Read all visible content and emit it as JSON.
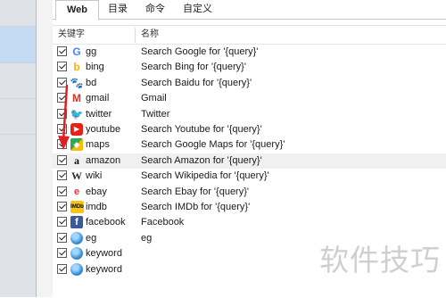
{
  "tabs": [
    {
      "label": "Web",
      "active": true
    },
    {
      "label": "目录",
      "active": false
    },
    {
      "label": "命令",
      "active": false
    },
    {
      "label": "自定义",
      "active": false
    }
  ],
  "table": {
    "columns": [
      "关键字",
      "名称"
    ],
    "rows": [
      {
        "keyword": "gg",
        "name": "Search Google for '{query}'",
        "icon": "google-icon",
        "checked": true
      },
      {
        "keyword": "bing",
        "name": "Search Bing for '{query}'",
        "icon": "bing-icon",
        "checked": true
      },
      {
        "keyword": "bd",
        "name": "Search Baidu for '{query}'",
        "icon": "baidu-icon",
        "checked": true
      },
      {
        "keyword": "gmail",
        "name": "Gmail",
        "icon": "gmail-icon",
        "checked": true
      },
      {
        "keyword": "twitter",
        "name": "Twitter",
        "icon": "twitter-icon",
        "checked": true
      },
      {
        "keyword": "youtube",
        "name": "Search Youtube for '{query}'",
        "icon": "youtube-icon",
        "checked": true
      },
      {
        "keyword": "maps",
        "name": "Search Google Maps for '{query}'",
        "icon": "maps-icon",
        "checked": true
      },
      {
        "keyword": "amazon",
        "name": "Search Amazon for '{query}'",
        "icon": "amazon-icon",
        "checked": true,
        "highlighted": true
      },
      {
        "keyword": "wiki",
        "name": "Search Wikipedia for '{query}'",
        "icon": "wikipedia-icon",
        "checked": true
      },
      {
        "keyword": "ebay",
        "name": "Search Ebay for '{query}'",
        "icon": "ebay-icon",
        "checked": true
      },
      {
        "keyword": "imdb",
        "name": "Search IMDb for '{query}'",
        "icon": "imdb-icon",
        "checked": true
      },
      {
        "keyword": "facebook",
        "name": "Facebook",
        "icon": "facebook-icon",
        "checked": true
      },
      {
        "keyword": "eg",
        "name": "eg",
        "icon": "globe-icon",
        "checked": true
      },
      {
        "keyword": "keyword",
        "name": "",
        "icon": "globe-icon",
        "checked": true
      },
      {
        "keyword": "keyword",
        "name": "",
        "icon": "globe-icon",
        "checked": true
      }
    ]
  },
  "icon_glyphs": {
    "google-icon": "G",
    "bing-icon": "b",
    "baidu-icon": "🐾",
    "gmail-icon": "M",
    "twitter-icon": "🐦",
    "youtube-icon": "▶",
    "maps-icon": "◆",
    "amazon-icon": "a",
    "wikipedia-icon": "W",
    "ebay-icon": "e",
    "imdb-icon": "IMDb",
    "facebook-icon": "f",
    "globe-icon": ""
  },
  "watermark": "软件技巧",
  "colors": {
    "arrow": "#e02020",
    "highlight_row": "#f0f0f0"
  }
}
